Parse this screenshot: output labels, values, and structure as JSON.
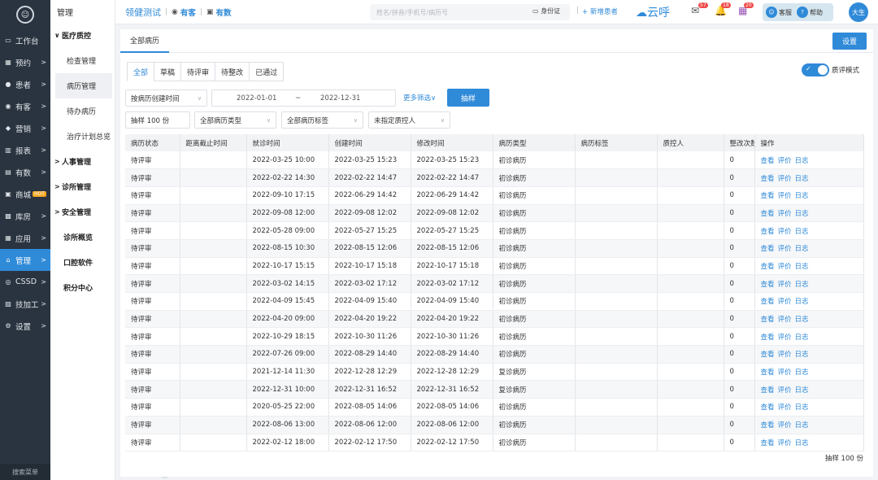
{
  "sidebar": {
    "items": [
      {
        "icon": "desktop-icon",
        "label": "工作台",
        "arrow": ""
      },
      {
        "icon": "calendar-icon",
        "label": "预约",
        "arrow": ">"
      },
      {
        "icon": "user-icon",
        "label": "患者",
        "arrow": ">"
      },
      {
        "icon": "eye-icon",
        "label": "有客",
        "arrow": ">"
      },
      {
        "icon": "chart-icon",
        "label": "营销",
        "arrow": ">"
      },
      {
        "icon": "bar-icon",
        "label": "报表",
        "arrow": ">"
      },
      {
        "icon": "data-icon",
        "label": "有数",
        "arrow": ">"
      },
      {
        "icon": "shop-icon",
        "label": "商城",
        "arrow": "",
        "hot": "HOT"
      },
      {
        "icon": "warehouse-icon",
        "label": "库房",
        "arrow": ">"
      },
      {
        "icon": "app-icon",
        "label": "应用",
        "arrow": ">"
      },
      {
        "icon": "home-icon",
        "label": "管理",
        "arrow": ">",
        "active": true
      },
      {
        "icon": "cssd-icon",
        "label": "CSSD",
        "arrow": ">"
      },
      {
        "icon": "tech-icon",
        "label": "技加工",
        "arrow": ">"
      },
      {
        "icon": "gear-icon",
        "label": "设置",
        "arrow": ">"
      }
    ],
    "search_label": "搜索菜单"
  },
  "submenu": {
    "title": "管理",
    "groups": [
      {
        "label": "医疗质控",
        "expanded": true,
        "children": [
          "检查管理",
          "病历管理",
          "待办病历",
          "治疗计划总览"
        ]
      },
      {
        "label": "人事管理"
      },
      {
        "label": "诊所管理"
      },
      {
        "label": "安全管理"
      }
    ],
    "plain": [
      "诊所概览",
      "口腔软件",
      "积分中心"
    ]
  },
  "header": {
    "brand": "领健测试",
    "youke": "有客",
    "youshu": "有数",
    "search_placeholder": "姓名/拼音/手机号/病历号",
    "idcard": "身份证",
    "add_patient": "+ 新增患者",
    "cloud": "云呼",
    "badge1": "57",
    "badge2": "18",
    "badge3": "20",
    "service": "客服",
    "help": "帮助",
    "avatar": "大生"
  },
  "page": {
    "tab": "全部病历",
    "settings": "设置",
    "status_tabs": [
      "全部",
      "草稿",
      "待评审",
      "待整改",
      "已通过"
    ],
    "toggle_label": "质评模式",
    "filters": {
      "sort": "按病历创建时间",
      "date_from": "2022-01-01",
      "date_sep": "~",
      "date_to": "2022-12-31",
      "more": "更多筛选",
      "sample_btn": "抽样",
      "sample_count": "抽样 100 份",
      "record_type": "全部病历类型",
      "record_tag": "全部病历标签",
      "qc_person": "未指定质控人"
    },
    "footer": "抽样 100 份"
  },
  "table": {
    "columns": [
      "病历状态",
      "距离截止时间",
      "就诊时间",
      "创建时间",
      "修改时间",
      "病历类型",
      "病历标签",
      "质控人",
      "整改次数",
      "操作"
    ],
    "actions": [
      "查看",
      "评价",
      "日志"
    ],
    "rows": [
      [
        "待评审",
        "",
        "2022-03-25 10:00",
        "2022-03-25 15:23",
        "2022-03-25 15:23",
        "初诊病历",
        "",
        "",
        "0"
      ],
      [
        "待评审",
        "",
        "2022-02-22 14:30",
        "2022-02-22 14:47",
        "2022-02-22 14:47",
        "初诊病历",
        "",
        "",
        "0"
      ],
      [
        "待评审",
        "",
        "2022-09-10 17:15",
        "2022-06-29 14:42",
        "2022-06-29 14:42",
        "初诊病历",
        "",
        "",
        "0"
      ],
      [
        "待评审",
        "",
        "2022-09-08 12:00",
        "2022-09-08 12:02",
        "2022-09-08 12:02",
        "初诊病历",
        "",
        "",
        "0"
      ],
      [
        "待评审",
        "",
        "2022-05-28 09:00",
        "2022-05-27 15:25",
        "2022-05-27 15:25",
        "初诊病历",
        "",
        "",
        "0"
      ],
      [
        "待评审",
        "",
        "2022-08-15 10:30",
        "2022-08-15 12:06",
        "2022-08-15 12:06",
        "初诊病历",
        "",
        "",
        "0"
      ],
      [
        "待评审",
        "",
        "2022-10-17 15:15",
        "2022-10-17 15:18",
        "2022-10-17 15:18",
        "初诊病历",
        "",
        "",
        "0"
      ],
      [
        "待评审",
        "",
        "2022-03-02 14:15",
        "2022-03-02 17:12",
        "2022-03-02 17:12",
        "初诊病历",
        "",
        "",
        "0"
      ],
      [
        "待评审",
        "",
        "2022-04-09 15:45",
        "2022-04-09 15:40",
        "2022-04-09 15:40",
        "初诊病历",
        "",
        "",
        "0"
      ],
      [
        "待评审",
        "",
        "2022-04-20 09:00",
        "2022-04-20 19:22",
        "2022-04-20 19:22",
        "初诊病历",
        "",
        "",
        "0"
      ],
      [
        "待评审",
        "",
        "2022-10-29 18:15",
        "2022-10-30 11:26",
        "2022-10-30 11:26",
        "初诊病历",
        "",
        "",
        "0"
      ],
      [
        "待评审",
        "",
        "2022-07-26 09:00",
        "2022-08-29 14:40",
        "2022-08-29 14:40",
        "初诊病历",
        "",
        "",
        "0"
      ],
      [
        "待评审",
        "",
        "2021-12-14 11:30",
        "2022-12-28 12:29",
        "2022-12-28 12:29",
        "复诊病历",
        "",
        "",
        "0"
      ],
      [
        "待评审",
        "",
        "2022-12-31 10:00",
        "2022-12-31 16:52",
        "2022-12-31 16:52",
        "复诊病历",
        "",
        "",
        "0"
      ],
      [
        "待评审",
        "",
        "2020-05-25 22:00",
        "2022-08-05 14:06",
        "2022-08-05 14:06",
        "初诊病历",
        "",
        "",
        "0"
      ],
      [
        "待评审",
        "",
        "2022-08-06 13:00",
        "2022-08-06 12:00",
        "2022-08-06 12:00",
        "初诊病历",
        "",
        "",
        "0"
      ],
      [
        "待评审",
        "",
        "2022-02-12 18:00",
        "2022-02-12 17:50",
        "2022-02-12 17:50",
        "初诊病历",
        "",
        "",
        "0"
      ]
    ]
  }
}
